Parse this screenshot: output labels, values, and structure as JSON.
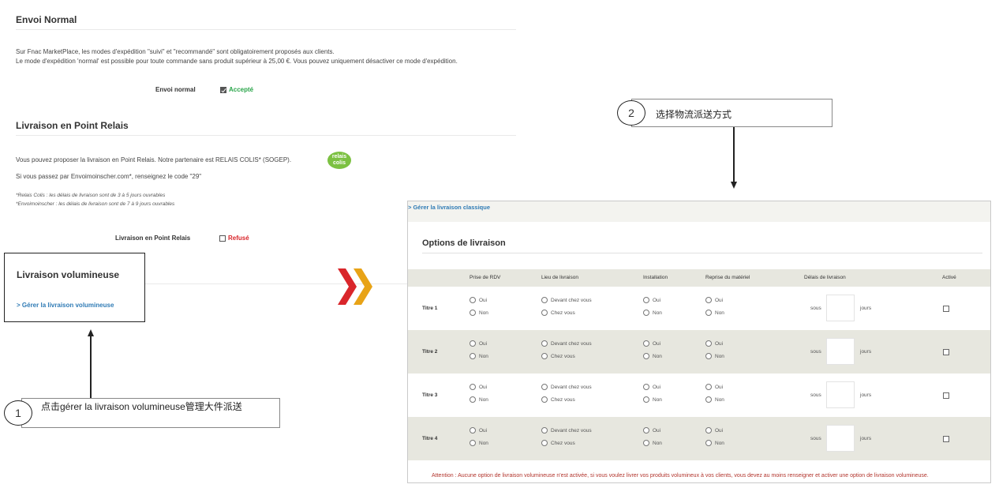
{
  "envoi_normal": {
    "title": "Envoi Normal",
    "line1": "Sur Fnac MarketPlace, les modes d'expédition \"suivi\" et \"recommandé\" sont obligatoirement proposés aux clients.",
    "line2": "Le mode d'expédition 'normal' est possible pour toute commande sans produit supérieur à 25,00 €. Vous pouvez uniquement désactiver ce mode d'expédition.",
    "row_label": "Envoi normal",
    "status": "Accepté",
    "status_color": "#2aa54a"
  },
  "point_relais": {
    "title": "Livraison en Point Relais",
    "line1": "Vous pouvez proposer la livraison en Point Relais. Notre partenaire est RELAIS COLIS* (SOGEP).",
    "logo_text_1": "relais",
    "logo_text_2": "colis",
    "line2": "Si vous passez par Envoimoinscher.com*, renseignez le code \"29\"",
    "note1": "*Relais Colis : les délais de livraison sont de 3 à 5 jours ouvrables",
    "note2": "*Envoimoinscher : les délais de livraison sont de 7 à 9 jours ouvrables",
    "row_label": "Livraison en Point Relais",
    "status": "Refusé",
    "status_color": "#d9262b"
  },
  "volumineuse": {
    "title": "Livraison volumineuse",
    "link": "> Gérer la livraison volumineuse"
  },
  "callouts": {
    "one": {
      "number": "1",
      "text": "点击gérer la livraison volumineuse管理大件派送"
    },
    "two": {
      "number": "2",
      "text": "选择物流派送方式"
    }
  },
  "panel": {
    "link": "> Gérer la livraison classique",
    "title": "Options de livraison",
    "columns": [
      "Prise de RDV",
      "Lieu de livraison",
      "Installation",
      "Reprise du matériel",
      "Délais de livraison",
      "Activé"
    ],
    "rows": [
      {
        "label": "Titre 1",
        "rdv": [
          "Oui",
          "Non"
        ],
        "lieu": [
          "Devant chez vous",
          "Chez vous"
        ],
        "installation": [
          "Oui",
          "Non"
        ],
        "reprise": [
          "Oui",
          "Non"
        ],
        "sous": "sous",
        "jours": "jours"
      },
      {
        "label": "Titre 2",
        "rdv": [
          "Oui",
          "Non"
        ],
        "lieu": [
          "Devant chez vous",
          "Chez vous"
        ],
        "installation": [
          "Oui",
          "Non"
        ],
        "reprise": [
          "Oui",
          "Non"
        ],
        "sous": "sous",
        "jours": "jours"
      },
      {
        "label": "Titre 3",
        "rdv": [
          "Oui",
          "Non"
        ],
        "lieu": [
          "Devant chez vous",
          "Chez vous"
        ],
        "installation": [
          "Oui",
          "Non"
        ],
        "reprise": [
          "Oui",
          "Non"
        ],
        "sous": "sous",
        "jours": "jours"
      },
      {
        "label": "Titre 4",
        "rdv": [
          "Oui",
          "Non"
        ],
        "lieu": [
          "Devant chez vous",
          "Chez vous"
        ],
        "installation": [
          "Oui",
          "Non"
        ],
        "reprise": [
          "Oui",
          "Non"
        ],
        "sous": "sous",
        "jours": "jours"
      }
    ],
    "warning": "Attention : Aucune option de livraison volumineuse n'est activée, si vous voulez livrer vos produits volumineux à vos clients, vous devez au moins renseigner et activer une option de livraison volumineuse.",
    "warning_color": "#b2342c"
  },
  "colors": {
    "link": "#2f7bb5",
    "chevron_red": "#d9262b",
    "chevron_yellow": "#e8a317"
  }
}
